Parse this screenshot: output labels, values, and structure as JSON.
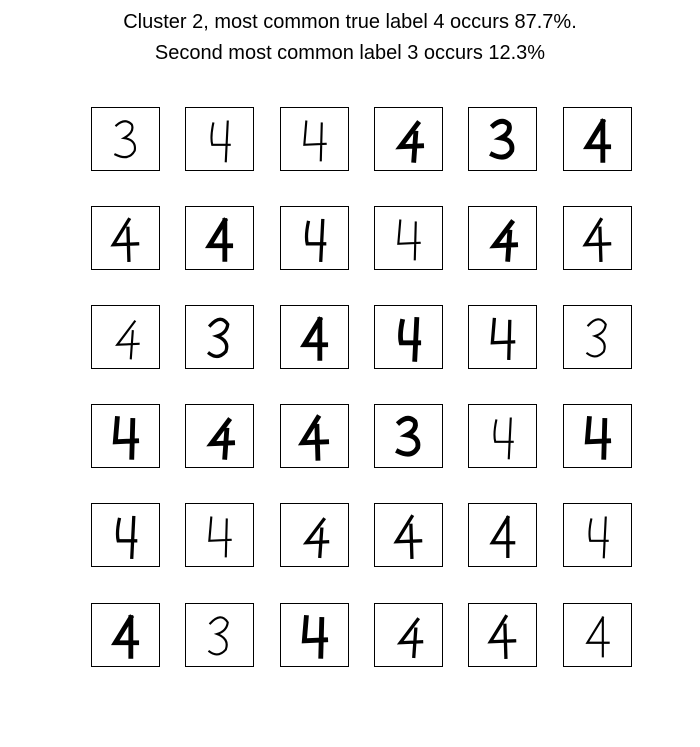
{
  "figure": {
    "title_line1": "Cluster 2, most common true label 4 occurs 87.7%.",
    "title_line2": "Second most common label 3 occurs 12.3%"
  },
  "image_grid": {
    "rows": 6,
    "cols": 6,
    "digits": [
      [
        "3",
        "4",
        "4",
        "4",
        "3",
        "4"
      ],
      [
        "4",
        "4",
        "4",
        "4",
        "4",
        "4"
      ],
      [
        "4",
        "3",
        "4",
        "4",
        "4",
        "3"
      ],
      [
        "4",
        "4",
        "4",
        "3",
        "4",
        "4"
      ],
      [
        "4",
        "4",
        "4",
        "4",
        "4",
        "4"
      ],
      [
        "4",
        "3",
        "4",
        "4",
        "4",
        "4"
      ]
    ],
    "stroke_weights": [
      [
        "thin",
        "thin",
        "thin",
        "bold",
        "bold",
        "bold"
      ],
      [
        "medium",
        "bold",
        "medium",
        "thin",
        "bold",
        "medium"
      ],
      [
        "thin",
        "medium",
        "bold",
        "bold",
        "medium",
        "thin"
      ],
      [
        "bold",
        "bold",
        "bold",
        "bold",
        "thin",
        "bold"
      ],
      [
        "medium",
        "thin",
        "medium",
        "medium",
        "medium",
        "thin"
      ],
      [
        "bold",
        "thin",
        "bold",
        "medium",
        "medium",
        "thin"
      ]
    ],
    "ink_color": "#000000",
    "background_color": "#ffffff"
  }
}
